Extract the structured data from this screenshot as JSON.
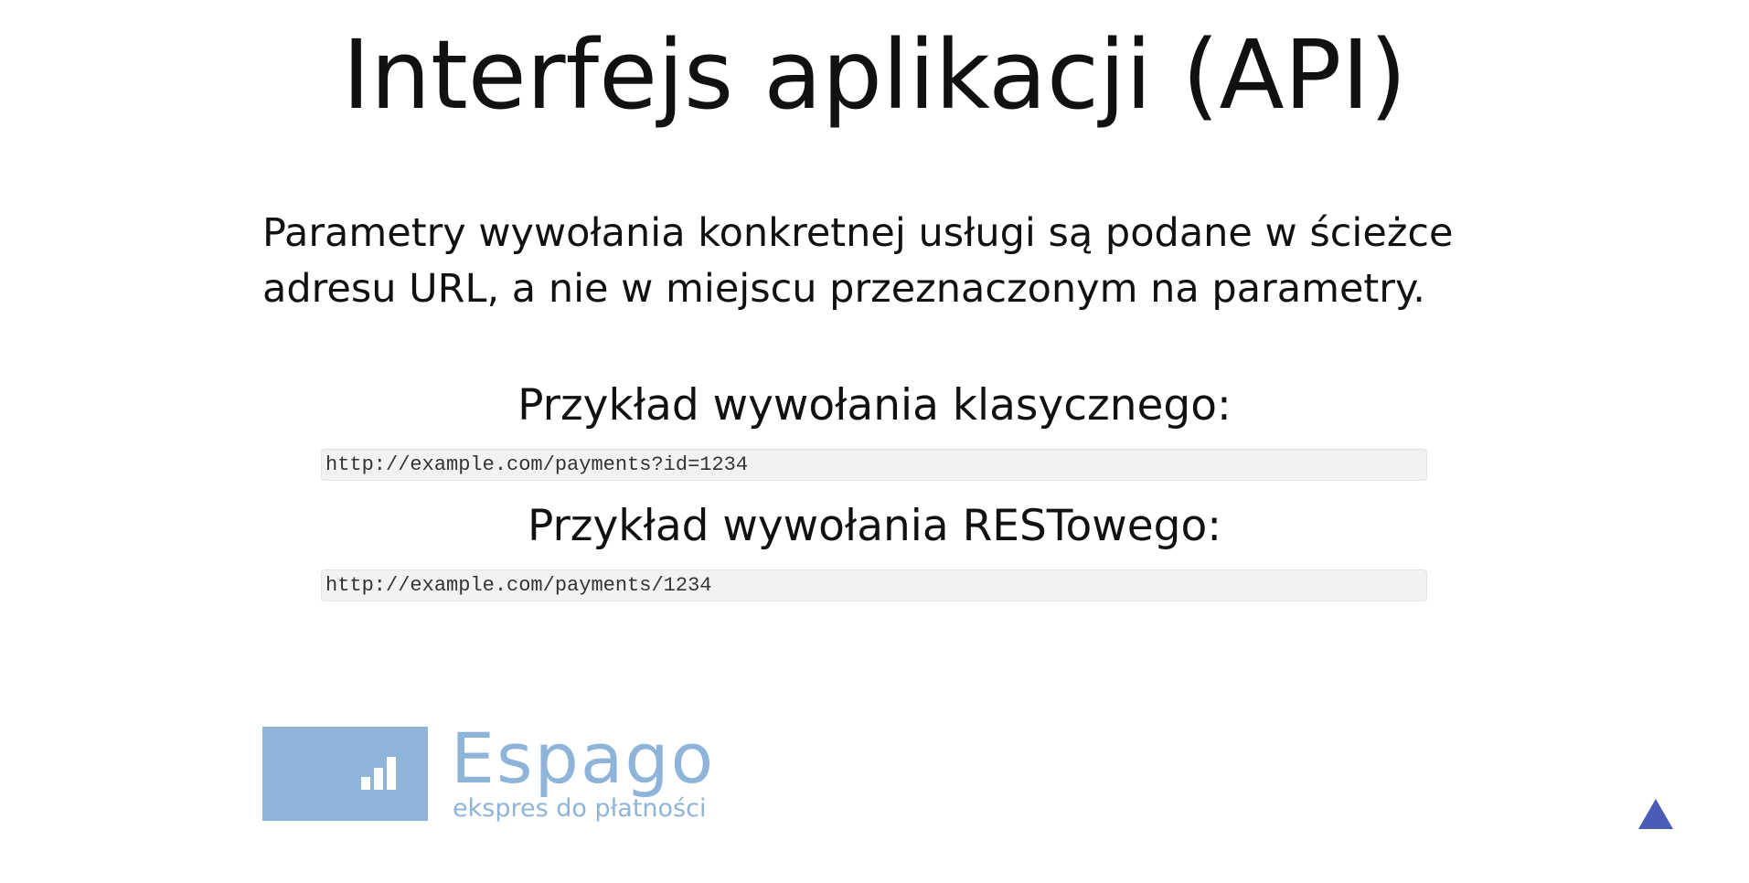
{
  "slide": {
    "title": "Interfejs aplikacji (API)",
    "description": "Parametry wywołania konkretnej usługi są podane w ścieżce adresu URL, a nie w miejscu przeznaczonym na parametry.",
    "examples": [
      {
        "heading": "Przykład wywołania klasycznego:",
        "code": "http://example.com/payments?id=1234"
      },
      {
        "heading": "Przykład wywołania RESTowego:",
        "code": "http://example.com/payments/1234"
      }
    ]
  },
  "logo": {
    "name": "Espago",
    "tagline": "ekspres do płatności",
    "color": "#8fb4d9"
  },
  "navigation": {
    "up_icon": "triangle-up-icon",
    "color": "#4a5bb8"
  }
}
